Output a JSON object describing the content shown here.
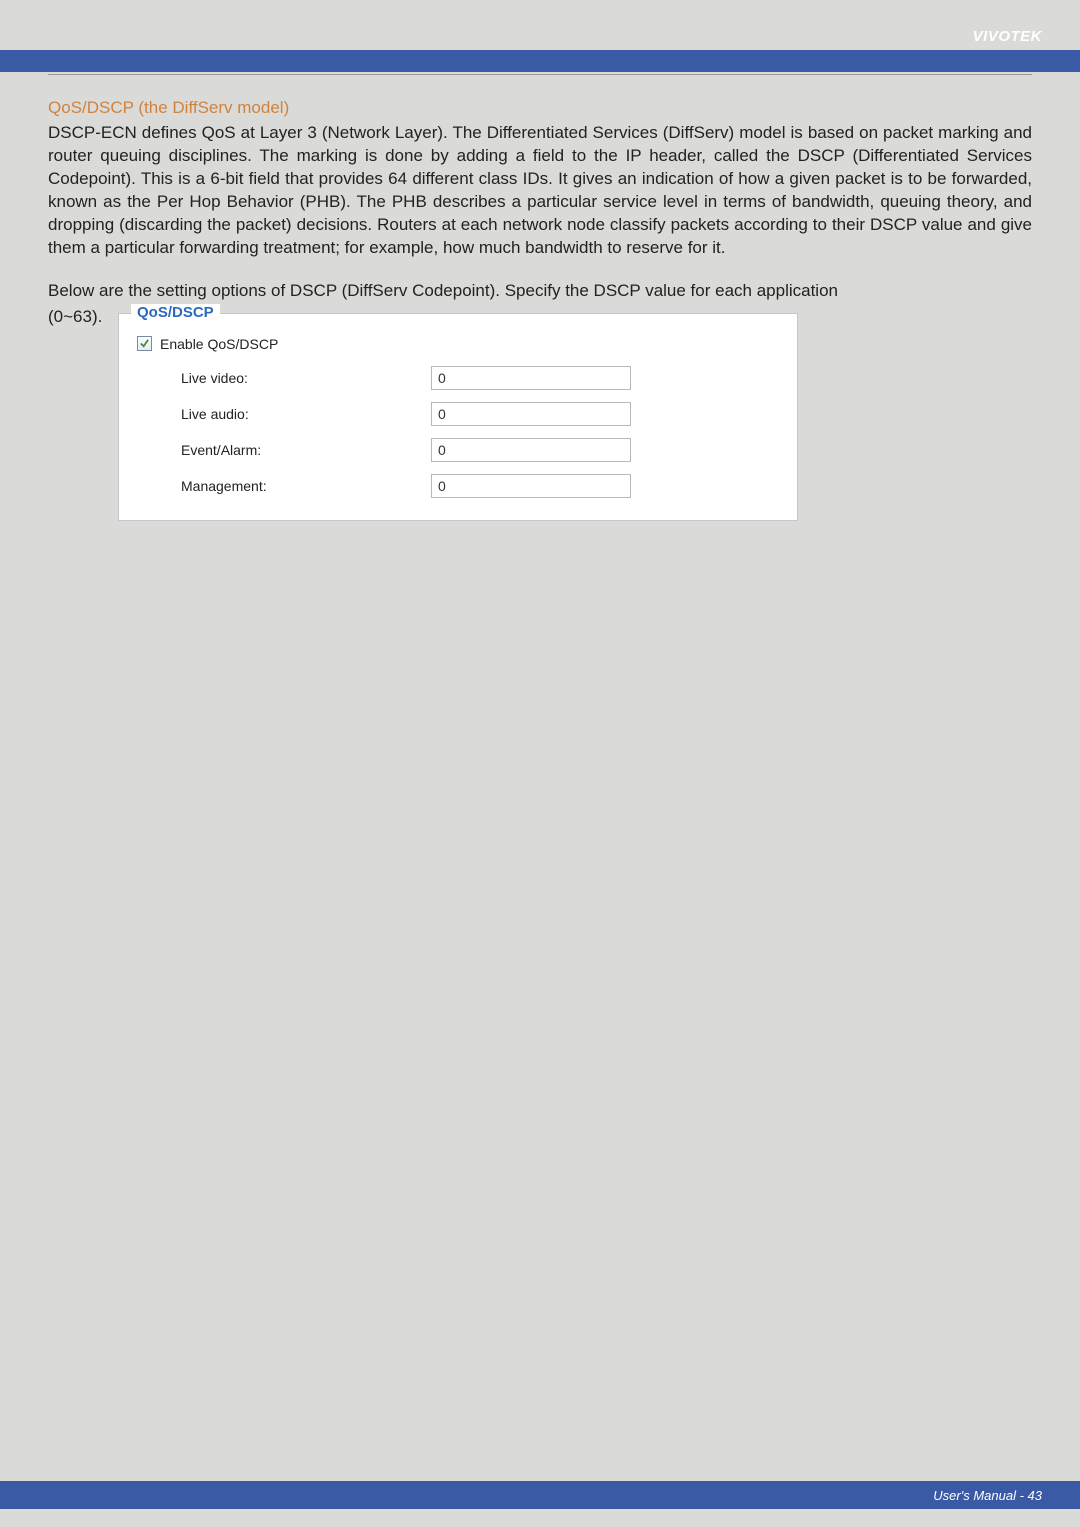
{
  "header": {
    "brand": "VIVOTEK"
  },
  "section": {
    "title": "QoS/DSCP (the DiffServ model)",
    "paragraph1": "DSCP-ECN defines QoS at Layer 3 (Network Layer). The Differentiated Services (DiffServ) model is based on packet marking and router queuing disciplines. The marking is done by adding a field to the IP header, called the DSCP (Differentiated Services Codepoint). This is a 6-bit field that provides 64 different class IDs. It gives an indication of how a given packet is to be forwarded, known as the Per Hop Behavior (PHB). The PHB describes a particular service level in terms of bandwidth, queuing theory, and dropping (discarding the packet) decisions. Routers at each network node classify packets according to their DSCP value and give them a particular forwarding treatment; for example, how much bandwidth to reserve for it.",
    "paragraph2": "Below are the setting options of DSCP (DiffServ Codepoint). Specify the DSCP value for each application (0~63).",
    "range_label": "(0~63)."
  },
  "panel": {
    "legend": "QoS/DSCP",
    "enable_label": "Enable QoS/DSCP",
    "fields": {
      "live_video": {
        "label": "Live video:",
        "value": "0"
      },
      "live_audio": {
        "label": "Live audio:",
        "value": "0"
      },
      "event_alarm": {
        "label": "Event/Alarm:",
        "value": "0"
      },
      "management": {
        "label": "Management:",
        "value": "0"
      }
    }
  },
  "footer": {
    "text": "User's Manual - 43"
  }
}
